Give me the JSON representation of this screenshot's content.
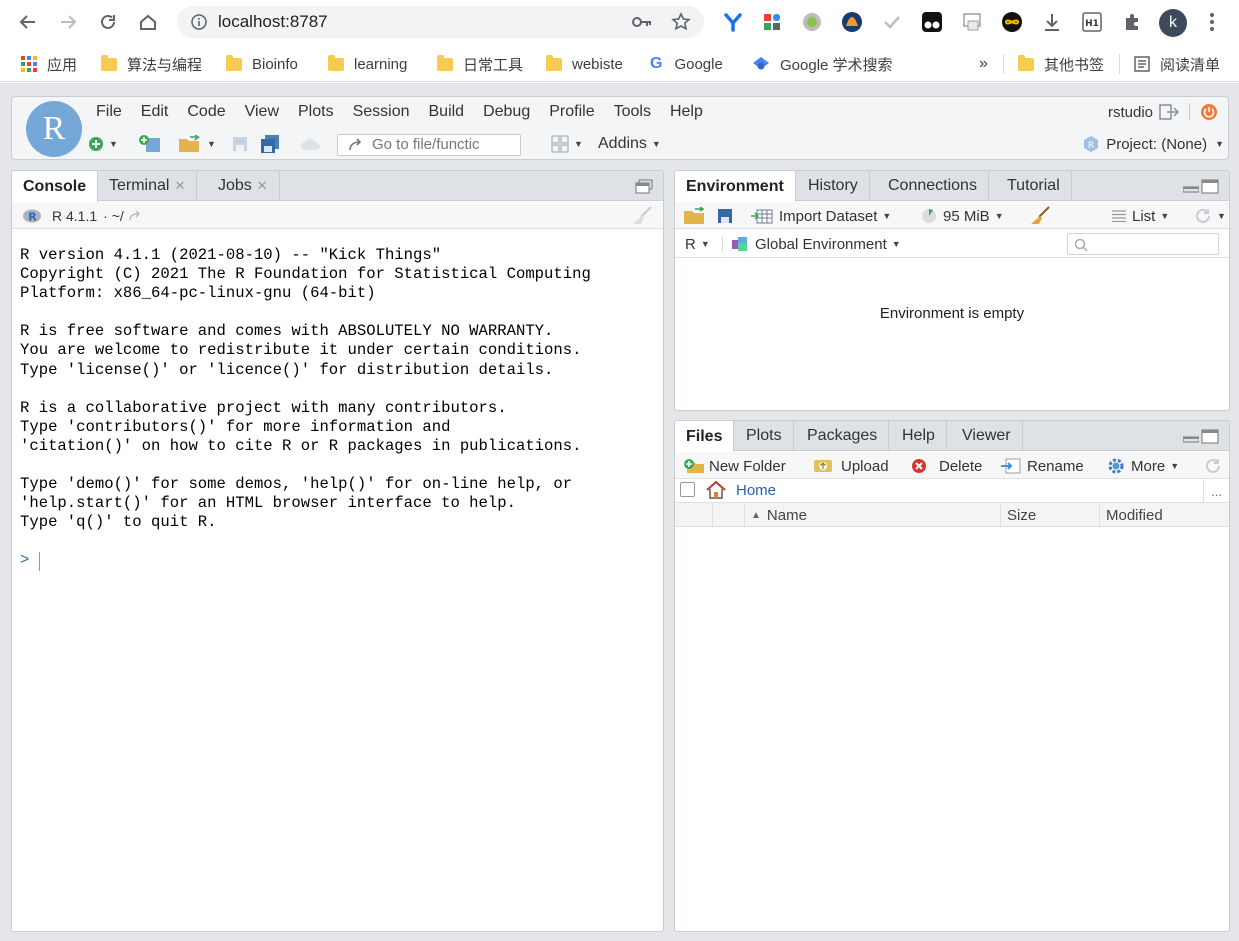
{
  "browser": {
    "url": "localhost:8787",
    "avatar_letter": "k",
    "more_bookmarks": "»",
    "bookmarks": [
      {
        "label": "应用",
        "icon": "apps-grid-icon"
      },
      {
        "label": "算法与编程",
        "icon": "folder-icon"
      },
      {
        "label": "Bioinfo",
        "icon": "folder-icon"
      },
      {
        "label": "learning",
        "icon": "folder-icon"
      },
      {
        "label": "日常工具",
        "icon": "folder-icon"
      },
      {
        "label": "webiste",
        "icon": "folder-icon"
      },
      {
        "label": "Google",
        "icon": "google-icon"
      },
      {
        "label": "Google 学术搜索",
        "icon": "scholar-icon"
      },
      {
        "label": "其他书签",
        "icon": "folder-icon"
      },
      {
        "label": "阅读清单",
        "icon": "reading-list-icon"
      }
    ]
  },
  "rstudio": {
    "menu": [
      "File",
      "Edit",
      "Code",
      "View",
      "Plots",
      "Session",
      "Build",
      "Debug",
      "Profile",
      "Tools",
      "Help"
    ],
    "user": "rstudio",
    "goto_placeholder": "Go to file/functic",
    "addins_label": "Addins",
    "project_label": "Project: (None)",
    "console": {
      "tabs": [
        {
          "label": "Console",
          "closable": false
        },
        {
          "label": "Terminal",
          "closable": true
        },
        {
          "label": "Jobs",
          "closable": true
        }
      ],
      "version_label": "R 4.1.1",
      "path_label": "· ~/",
      "text": "R version 4.1.1 (2021-08-10) -- \"Kick Things\"\nCopyright (C) 2021 The R Foundation for Statistical Computing\nPlatform: x86_64-pc-linux-gnu (64-bit)\n\nR is free software and comes with ABSOLUTELY NO WARRANTY.\nYou are welcome to redistribute it under certain conditions.\nType 'license()' or 'licence()' for distribution details.\n\nR is a collaborative project with many contributors.\nType 'contributors()' for more information and\n'citation()' on how to cite R or R packages in publications.\n\nType 'demo()' for some demos, 'help()' for on-line help, or\n'help.start()' for an HTML browser interface to help.\nType 'q()' to quit R.",
      "prompt": ">"
    },
    "environment": {
      "tabs": [
        "Environment",
        "History",
        "Connections",
        "Tutorial"
      ],
      "import_label": "Import Dataset",
      "memory_label": "95 MiB",
      "list_label": "List",
      "lang_label": "R",
      "scope_label": "Global Environment",
      "empty_message": "Environment is empty"
    },
    "files": {
      "tabs": [
        "Files",
        "Plots",
        "Packages",
        "Help",
        "Viewer"
      ],
      "actions": {
        "new_folder": "New Folder",
        "upload": "Upload",
        "delete": "Delete",
        "rename": "Rename",
        "more": "More"
      },
      "breadcrumb": "Home",
      "ellipsis": "...",
      "columns": {
        "name": "Name",
        "size": "Size",
        "modified": "Modified"
      }
    }
  }
}
